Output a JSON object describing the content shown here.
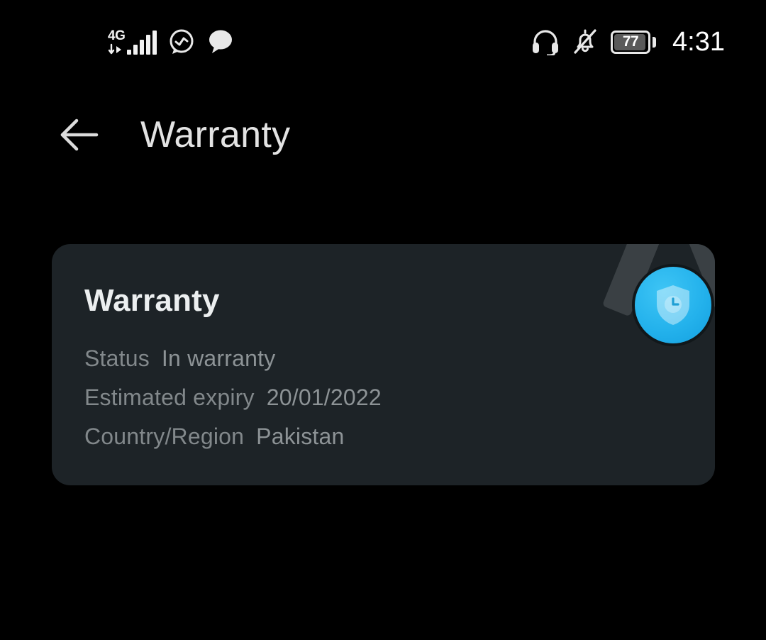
{
  "status_bar": {
    "network_type": "4G",
    "data_arrows_icon": "data-transfer-arrows-icon",
    "signal_icon": "signal-bars-icon",
    "messenger_icon": "messenger-icon",
    "sms_icon": "speech-bubble-icon",
    "headphones_icon": "headphones-icon",
    "bell_muted_icon": "bell-muted-icon",
    "battery_icon": "battery-icon",
    "battery_level": "77",
    "time": "4:31"
  },
  "app_bar": {
    "back_icon": "arrow-left-icon",
    "title": "Warranty"
  },
  "card": {
    "title": "Warranty",
    "rows": [
      {
        "label": "Status",
        "value": "In warranty"
      },
      {
        "label": "Estimated expiry",
        "value": "20/01/2022"
      },
      {
        "label": "Country/Region",
        "value": "Pakistan"
      }
    ],
    "medal": {
      "icon": "warranty-medal-icon",
      "shield_icon": "shield-clock-icon",
      "disc_color": "#24b2ec",
      "ribbon_color": "#3a4044"
    },
    "background_color": "#1d2327"
  },
  "theme": {
    "page_background": "#000000",
    "primary_text": "#e3e3e3",
    "secondary_text": "#82888b",
    "accent": "#24b2ec"
  }
}
